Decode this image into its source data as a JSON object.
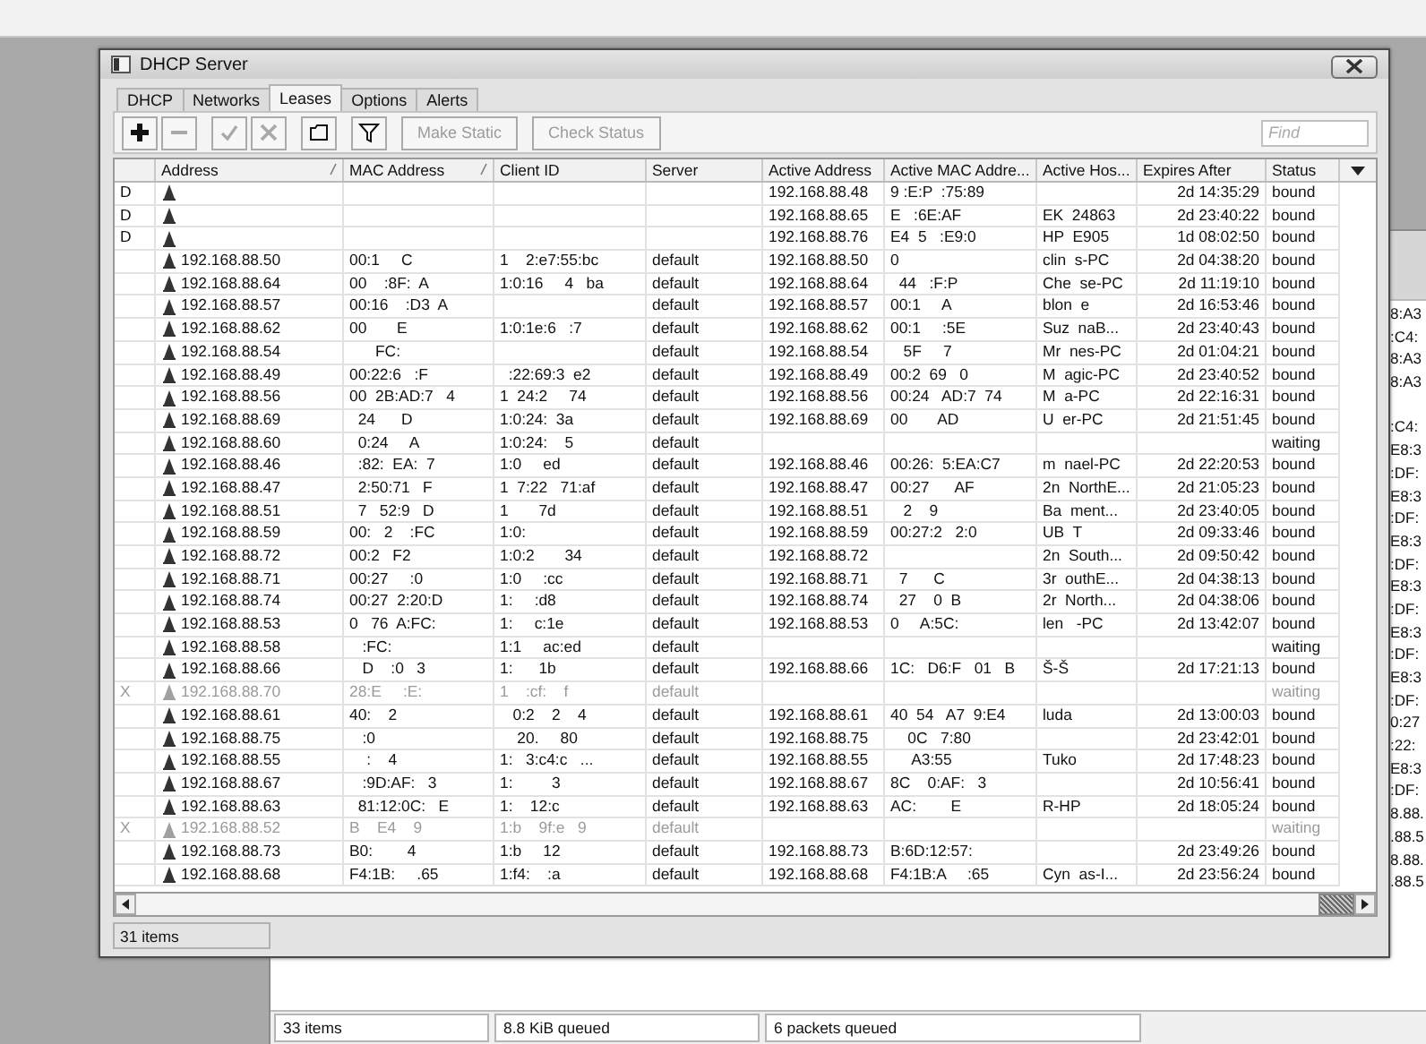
{
  "window": {
    "title": "DHCP Server"
  },
  "tabs": [
    {
      "label": "DHCP",
      "selected": false
    },
    {
      "label": "Networks",
      "selected": false
    },
    {
      "label": "Leases",
      "selected": true
    },
    {
      "label": "Options",
      "selected": false
    },
    {
      "label": "Alerts",
      "selected": false
    }
  ],
  "toolbar": [
    {
      "kind": "add",
      "disabled": false
    },
    {
      "kind": "remove",
      "disabled": true
    },
    {
      "kind": "enable",
      "disabled": true
    },
    {
      "kind": "disable",
      "disabled": true
    },
    {
      "kind": "comment",
      "disabled": false
    },
    {
      "kind": "filter",
      "disabled": false
    },
    {
      "kind": "text",
      "label": "Make Static",
      "disabled": true
    },
    {
      "kind": "text",
      "label": "Check Status",
      "disabled": true
    }
  ],
  "search": {
    "placeholder": "Find"
  },
  "table": {
    "columns": [
      {
        "label": "Address",
        "sorted": true
      },
      {
        "label": "MAC Address",
        "sorted": true
      },
      {
        "label": "Client ID",
        "sorted": false
      },
      {
        "label": "Server",
        "sorted": false
      },
      {
        "label": "Active Address",
        "sorted": false
      },
      {
        "label": "Active MAC Addre...",
        "sorted": false
      },
      {
        "label": "Active Hos...",
        "sorted": false
      },
      {
        "label": "Expires After",
        "sorted": false
      },
      {
        "label": "Status",
        "sorted": false
      }
    ],
    "rows": [
      {
        "flag": "D",
        "disabled": false,
        "active_address": "192.168.88.48",
        "active_mac_address": "9 :E:P  :75:89",
        "expires_after": "2d 14:35:29",
        "status": "bound"
      },
      {
        "flag": "D",
        "disabled": false,
        "active_address": "192.168.88.65",
        "active_mac_address": "E   :6E:AF",
        "active_host": "EK  24863",
        "expires_after": "2d 23:40:22",
        "status": "bound"
      },
      {
        "flag": "D",
        "disabled": false,
        "active_address": "192.168.88.76",
        "active_mac_address": "E4  5   :E9:0",
        "active_host": "HP  E905",
        "expires_after": "1d 08:02:50",
        "status": "bound"
      },
      {
        "disabled": false,
        "address": "192.168.88.50",
        "mac_address": "00:1     C",
        "client_id": "1    2:e7:55:bc",
        "server": "default",
        "active_address": "192.168.88.50",
        "active_mac_address": "0",
        "active_host": "clin  s-PC",
        "expires_after": "2d 04:38:20",
        "status": "bound"
      },
      {
        "disabled": false,
        "address": "192.168.88.64",
        "mac_address": "00    :8F:  A",
        "client_id": "1:0:16     4   ba",
        "server": "default",
        "active_address": "192.168.88.64",
        "active_mac_address": "  44   :F:P",
        "active_host": "Che  se-PC",
        "expires_after": "2d 11:19:10",
        "status": "bound"
      },
      {
        "disabled": false,
        "address": "192.168.88.57",
        "mac_address": "00:16    :D3  A",
        "server": "default",
        "active_address": "192.168.88.57",
        "active_mac_address": "00:1     A",
        "active_host": "blon  e",
        "expires_after": "2d 16:53:46",
        "status": "bound"
      },
      {
        "disabled": false,
        "address": "192.168.88.62",
        "mac_address": "00       E",
        "client_id": "1:0:1e:6   :7",
        "server": "default",
        "active_address": "192.168.88.62",
        "active_mac_address": "00:1     :5E",
        "active_host": "Suz  naB...",
        "expires_after": "2d 23:40:43",
        "status": "bound"
      },
      {
        "disabled": false,
        "address": "192.168.88.54",
        "mac_address": "      FC:",
        "server": "default",
        "active_address": "192.168.88.54",
        "active_mac_address": "   5F     7",
        "active_host": "Mr  nes-PC",
        "expires_after": "2d 01:04:21",
        "status": "bound"
      },
      {
        "disabled": false,
        "address": "192.168.88.49",
        "mac_address": "00:22:6   :F",
        "client_id": "  :22:69:3  e2",
        "server": "default",
        "active_address": "192.168.88.49",
        "active_mac_address": "00:2  69   0",
        "active_host": "M  agic-PC",
        "expires_after": "2d 23:40:52",
        "status": "bound"
      },
      {
        "disabled": false,
        "address": "192.168.88.56",
        "mac_address": "00  2B:AD:7   4",
        "client_id": "1  24:2     74",
        "server": "default",
        "active_address": "192.168.88.56",
        "active_mac_address": "00:24   AD:7  74",
        "active_host": "M  a-PC",
        "expires_after": "2d 22:16:31",
        "status": "bound"
      },
      {
        "disabled": false,
        "address": "192.168.88.69",
        "mac_address": "  24      D",
        "client_id": "1:0:24:  3a",
        "server": "default",
        "active_address": "192.168.88.69",
        "active_mac_address": "00       AD",
        "active_host": "U  er-PC",
        "expires_after": "2d 21:51:45",
        "status": "bound"
      },
      {
        "disabled": false,
        "address": "192.168.88.60",
        "mac_address": "  0:24     A",
        "client_id": "1:0:24:    5",
        "server": "default",
        "status": "waiting"
      },
      {
        "disabled": false,
        "address": "192.168.88.46",
        "mac_address": "  :82:  EA:  7",
        "client_id": "1:0     ed",
        "server": "default",
        "active_address": "192.168.88.46",
        "active_mac_address": "00:26:  5:EA:C7",
        "active_host": "m  nael-PC",
        "expires_after": "2d 22:20:53",
        "status": "bound"
      },
      {
        "disabled": false,
        "address": "192.168.88.47",
        "mac_address": "  2:50:71   F",
        "client_id": "1  7:22   71:af",
        "server": "default",
        "active_address": "192.168.88.47",
        "active_mac_address": "00:27      AF",
        "active_host": "2n  NorthE...",
        "expires_after": "2d 21:05:23",
        "status": "bound"
      },
      {
        "disabled": false,
        "address": "192.168.88.51",
        "mac_address": "  7   52:9   D",
        "client_id": "1       7d",
        "server": "default",
        "active_address": "192.168.88.51",
        "active_mac_address": "   2    9",
        "active_host": "Ba  ment...",
        "expires_after": "2d 23:40:05",
        "status": "bound"
      },
      {
        "disabled": false,
        "address": "192.168.88.59",
        "mac_address": "00:   2    :FC",
        "client_id": "1:0:",
        "server": "default",
        "active_address": "192.168.88.59",
        "active_mac_address": "00:27:2   2:0",
        "active_host": "UB  T",
        "expires_after": "2d 09:33:46",
        "status": "bound"
      },
      {
        "disabled": false,
        "address": "192.168.88.72",
        "mac_address": "00:2   F2",
        "client_id": "1:0:2       34",
        "server": "default",
        "active_address": "192.168.88.72",
        "active_host": "2n  South...",
        "expires_after": "2d 09:50:42",
        "status": "bound"
      },
      {
        "disabled": false,
        "address": "192.168.88.71",
        "mac_address": "00:27     :0",
        "client_id": "1:0     :cc",
        "server": "default",
        "active_address": "192.168.88.71",
        "active_mac_address": "  7      C",
        "active_host": "3r  outhE...",
        "expires_after": "2d 04:38:13",
        "status": "bound"
      },
      {
        "disabled": false,
        "address": "192.168.88.74",
        "mac_address": "00:27  2:20:D",
        "client_id": "1:     :d8",
        "server": "default",
        "active_address": "192.168.88.74",
        "active_mac_address": "  27    0  B",
        "active_host": "2r  North...",
        "expires_after": "2d 04:38:06",
        "status": "bound"
      },
      {
        "disabled": false,
        "address": "192.168.88.53",
        "mac_address": "0   76  A:FC:",
        "client_id": "1:     c:1e",
        "server": "default",
        "active_address": "192.168.88.53",
        "active_mac_address": "0     A:5C:",
        "active_host": "len   -PC",
        "expires_after": "2d 13:42:07",
        "status": "bound"
      },
      {
        "disabled": false,
        "address": "192.168.88.58",
        "mac_address": "   :FC:",
        "client_id": "1:1     ac:ed",
        "server": "default",
        "status": "waiting"
      },
      {
        "disabled": false,
        "address": "192.168.88.66",
        "mac_address": "   D    :0   3",
        "client_id": "1:      1b",
        "server": "default",
        "active_address": "192.168.88.66",
        "active_mac_address": "1C:   D6:F   01   B",
        "active_host": "Š-Š",
        "expires_after": "2d 17:21:13",
        "status": "bound"
      },
      {
        "flag": "X",
        "disabled": true,
        "address": "192.168.88.70",
        "mac_address": "28:E     :E:",
        "client_id": "1    :cf:    f",
        "server": "default",
        "status": "waiting"
      },
      {
        "disabled": false,
        "address": "192.168.88.61",
        "mac_address": "40:    2",
        "client_id": "   0:2    2    4",
        "server": "default",
        "active_address": "192.168.88.61",
        "active_mac_address": "40  54   A7  9:E4",
        "active_host": "luda",
        "expires_after": "2d 13:00:03",
        "status": "bound"
      },
      {
        "disabled": false,
        "address": "192.168.88.75",
        "mac_address": "   :0",
        "client_id": "    20.     80",
        "server": "default",
        "active_address": "192.168.88.75",
        "active_mac_address": "    0C   7:80",
        "expires_after": "2d 23:42:01",
        "status": "bound"
      },
      {
        "disabled": false,
        "address": "192.168.88.55",
        "mac_address": "    :    4",
        "client_id": "1:   3:c4:c   ...",
        "server": "default",
        "active_address": "192.168.88.55",
        "active_mac_address": "     A3:55",
        "active_host": "Tuko",
        "expires_after": "2d 17:48:23",
        "status": "bound"
      },
      {
        "disabled": false,
        "address": "192.168.88.67",
        "mac_address": "   :9D:AF:   3",
        "client_id": "1:         3",
        "server": "default",
        "active_address": "192.168.88.67",
        "active_mac_address": "8C    0:AF:   3",
        "expires_after": "2d 10:56:41",
        "status": "bound"
      },
      {
        "disabled": false,
        "address": "192.168.88.63",
        "mac_address": "  81:12:0C:   E",
        "client_id": "1:    12:c",
        "server": "default",
        "active_address": "192.168.88.63",
        "active_mac_address": "AC:        E",
        "active_host": "R-HP",
        "expires_after": "2d 18:05:24",
        "status": "bound"
      },
      {
        "flag": "X",
        "disabled": true,
        "address": "192.168.88.52",
        "mac_address": "B    E4    9",
        "client_id": "1:b    9f:e   9",
        "server": "default",
        "status": "waiting"
      },
      {
        "disabled": false,
        "address": "192.168.88.73",
        "mac_address": "B0:        4",
        "client_id": "1:b     12",
        "server": "default",
        "active_address": "192.168.88.73",
        "active_mac_address": "B:6D:12:57:",
        "expires_after": "2d 23:49:26",
        "status": "bound"
      },
      {
        "disabled": false,
        "address": "192.168.88.68",
        "mac_address": "F4:1B:     .65",
        "client_id": "1:f4:    :a",
        "server": "default",
        "active_address": "192.168.88.68",
        "active_mac_address": "F4:1B:A     :65",
        "active_host": "Cyn  as-I...",
        "expires_after": "2d 23:56:24",
        "status": "bound"
      }
    ]
  },
  "status_bar": "31 items",
  "background_window": {
    "fragment_groups": [
      [
        "8:A3",
        ":C4:",
        "8:A3",
        "8:A3"
      ],
      [
        ":C4:",
        "E8:3",
        ":DF:",
        "E8:3",
        ":DF:",
        "E8:3",
        ":DF:",
        "E8:3",
        ":DF:",
        "E8:3",
        ":DF:",
        "E8:3",
        ":DF:",
        "0:27",
        ":22:",
        "E8:3",
        ":DF:",
        "8.88.",
        ".88.5",
        "8.88.",
        ".88.5"
      ]
    ],
    "status_bar": [
      "33 items",
      "8.8 KiB queued",
      "6 packets queued"
    ]
  }
}
